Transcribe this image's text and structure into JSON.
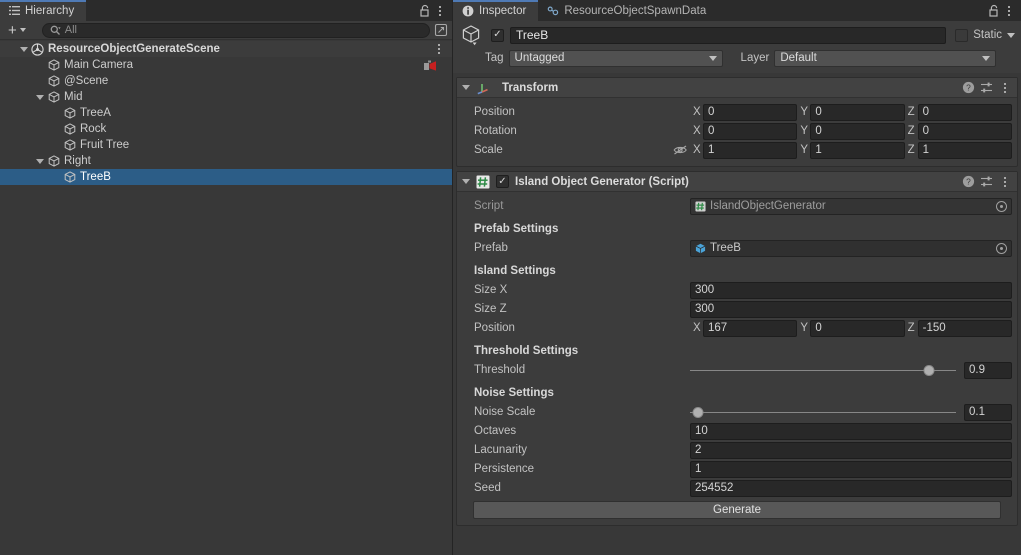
{
  "hierarchy": {
    "tab_label": "Hierarchy",
    "toolbar": {
      "add_label": "+",
      "search_placeholder": "All"
    },
    "items": [
      {
        "label": "ResourceObjectGenerateScene",
        "depth": 0,
        "kind": "scene",
        "expanded": true,
        "selected": false
      },
      {
        "label": "Main Camera",
        "depth": 1,
        "kind": "gameobject",
        "expanded": false,
        "selected": false,
        "overlay": "camera-overlay-icon"
      },
      {
        "label": "@Scene",
        "depth": 1,
        "kind": "gameobject",
        "expanded": false,
        "selected": false
      },
      {
        "label": "Mid",
        "depth": 1,
        "kind": "gameobject",
        "expanded": true,
        "selected": false
      },
      {
        "label": "TreeA",
        "depth": 2,
        "kind": "gameobject",
        "expanded": false,
        "selected": false
      },
      {
        "label": "Rock",
        "depth": 2,
        "kind": "gameobject",
        "expanded": false,
        "selected": false
      },
      {
        "label": "Fruit Tree",
        "depth": 2,
        "kind": "gameobject",
        "expanded": false,
        "selected": false
      },
      {
        "label": "Right",
        "depth": 1,
        "kind": "gameobject",
        "expanded": true,
        "selected": false
      },
      {
        "label": "TreeB",
        "depth": 2,
        "kind": "gameobject",
        "expanded": false,
        "selected": true
      }
    ]
  },
  "inspector": {
    "tabs": [
      {
        "label": "Inspector",
        "icon": "info-icon",
        "active": true
      },
      {
        "label": "ResourceObjectSpawnData",
        "icon": "scriptable-object-icon",
        "active": false
      }
    ],
    "gameobject": {
      "enabled": true,
      "name": "TreeB",
      "static_label": "Static",
      "static_checked": false,
      "tag_label": "Tag",
      "tag_value": "Untagged",
      "layer_label": "Layer",
      "layer_value": "Default"
    },
    "transform": {
      "title": "Transform",
      "rows": [
        {
          "label": "Position",
          "x": "0",
          "y": "0",
          "z": "0"
        },
        {
          "label": "Rotation",
          "x": "0",
          "y": "0",
          "z": "0"
        },
        {
          "label": "Scale",
          "x": "1",
          "y": "1",
          "z": "1"
        }
      ],
      "axis_x": "X",
      "axis_y": "Y",
      "axis_z": "Z"
    },
    "generator": {
      "title": "Island Object Generator (Script)",
      "enabled": true,
      "script_label": "Script",
      "script_value": "IslandObjectGenerator",
      "prefab_section": "Prefab Settings",
      "prefab_label": "Prefab",
      "prefab_value": "TreeB",
      "island_section": "Island Settings",
      "size_x_label": "Size X",
      "size_x_value": "300",
      "size_z_label": "Size Z",
      "size_z_value": "300",
      "position_label": "Position",
      "position_x": "167",
      "position_y": "0",
      "position_z": "-150",
      "threshold_section": "Threshold Settings",
      "threshold_label": "Threshold",
      "threshold_value": "0.9",
      "threshold_percent": 90,
      "noise_section": "Noise Settings",
      "noise_scale_label": "Noise Scale",
      "noise_scale_value": "0.1",
      "noise_scale_percent": 3,
      "octaves_label": "Octaves",
      "octaves_value": "10",
      "lacunarity_label": "Lacunarity",
      "lacunarity_value": "2",
      "persistence_label": "Persistence",
      "persistence_value": "1",
      "seed_label": "Seed",
      "seed_value": "254552",
      "generate_label": "Generate"
    }
  },
  "colors": {
    "panel_bg": "#383838",
    "header_bg": "#3c3c3c",
    "selection_blue": "#2c5d87",
    "tab_accent": "#4f7ab5",
    "field_bg": "#282828",
    "button_bg": "#585858"
  }
}
